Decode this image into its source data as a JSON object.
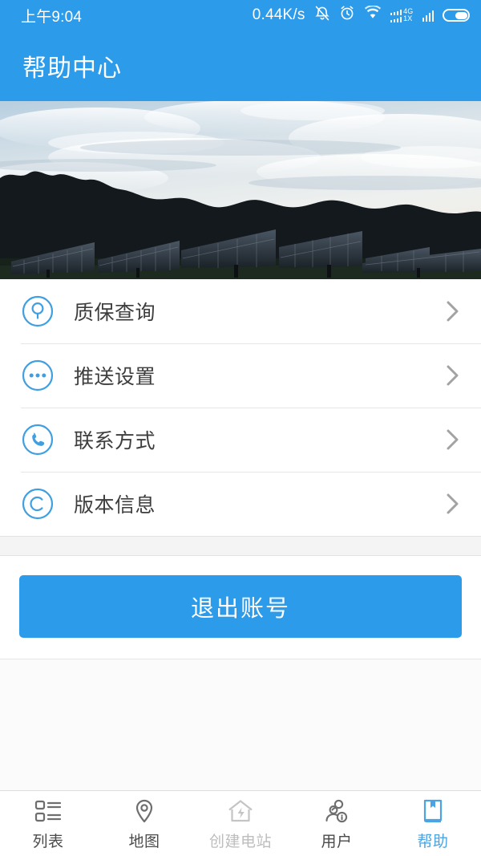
{
  "theme": {
    "accent": "#2b9bea",
    "accent_light": "#4ba3e3",
    "icon_blue": "#3f9fe0",
    "text_dark": "#3d3d3d",
    "text_muted": "#9a9a9a",
    "disabled": "#bdbdbd",
    "page_bg": "#f2f2f2"
  },
  "status_bar": {
    "time": "上午9:04",
    "net_speed": "0.44K/s",
    "network_type": "4G",
    "network_sub": "1X",
    "icons": [
      "mute-bell-icon",
      "alarm-clock-icon",
      "wifi-icon",
      "signal-bars-icon",
      "battery-icon"
    ]
  },
  "header": {
    "title": "帮助中心"
  },
  "hero": {
    "alt": "solar-panel-farm-photo"
  },
  "menu": {
    "items": [
      {
        "icon": "search-circle-icon",
        "label": "质保查询",
        "chevron": "chevron-right-icon"
      },
      {
        "icon": "dots-circle-icon",
        "label": "推送设置",
        "chevron": "chevron-right-icon"
      },
      {
        "icon": "phone-circle-icon",
        "label": "联系方式",
        "chevron": "chevron-right-icon"
      },
      {
        "icon": "copyright-circle-icon",
        "label": "版本信息",
        "chevron": "chevron-right-icon"
      }
    ]
  },
  "logout": {
    "label": "退出账号"
  },
  "tabbar": {
    "tabs": [
      {
        "icon": "list-icon",
        "label": "列表",
        "state": "normal"
      },
      {
        "icon": "map-pin-icon",
        "label": "地图",
        "state": "normal"
      },
      {
        "icon": "house-bolt-icon",
        "label": "创建电站",
        "state": "disabled"
      },
      {
        "icon": "users-info-icon",
        "label": "用户",
        "state": "normal"
      },
      {
        "icon": "book-bookmark-icon",
        "label": "帮助",
        "state": "active"
      }
    ]
  }
}
